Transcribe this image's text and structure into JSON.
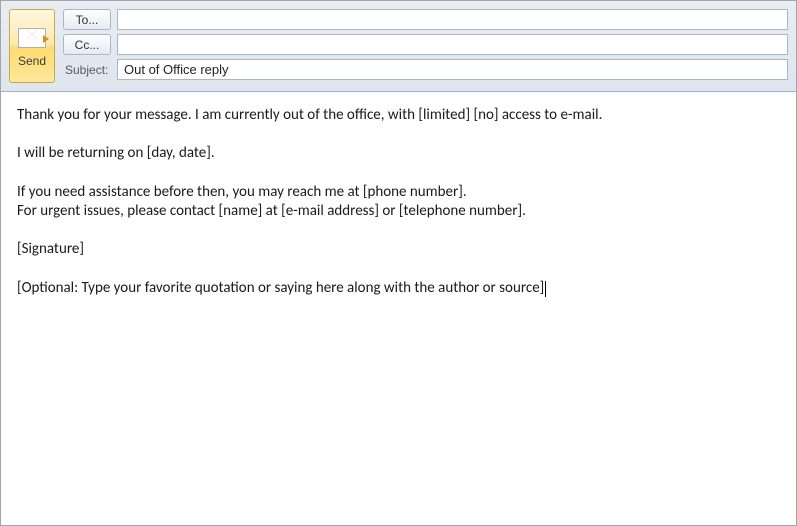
{
  "header": {
    "send_label": "Send",
    "to_label": "To...",
    "cc_label": "Cc...",
    "subject_label": "Subject:",
    "to_value": "",
    "cc_value": "",
    "subject_value": "Out of Office reply"
  },
  "body": {
    "line1": "Thank you for your message. I am currently out of the office, with [limited] [no] access to e-mail.",
    "line2": "I will be returning on [day, date].",
    "line3": "If you need assistance before then, you may reach me at [phone number].",
    "line4": "For urgent issues, please contact [name] at [e-mail address] or [telephone number].",
    "line5": "[Signature]",
    "line6": "[Optional: Type your favorite quotation or saying here along with the author or source]"
  }
}
